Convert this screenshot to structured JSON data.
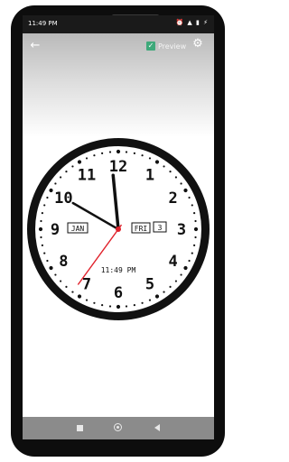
{
  "status_bar": {
    "time": "11:49 PM",
    "icons_text": "⏰ ▲ ▮ ⚡"
  },
  "app_bar": {
    "back_icon": "arrow-left-icon",
    "preview_label": "Preview",
    "preview_checked": true,
    "settings_icon": "gear-icon"
  },
  "clock": {
    "numerals": [
      "12",
      "1",
      "2",
      "3",
      "4",
      "5",
      "6",
      "7",
      "8",
      "9",
      "10",
      "11"
    ],
    "month": "JAN",
    "weekday": "FRI",
    "day": "3",
    "digital_time": "11:49 PM",
    "hands": {
      "hour": 11,
      "minute": 49,
      "second": 35
    },
    "colors": {
      "ring": "#111111",
      "face": "#ffffff",
      "hand": "#111111",
      "second_hand": "#e0202a",
      "center": "#e0202a"
    }
  },
  "nav_bar": {
    "recents_icon": "square-recents-icon",
    "home_icon": "circle-home-icon",
    "back_icon": "triangle-back-icon"
  }
}
